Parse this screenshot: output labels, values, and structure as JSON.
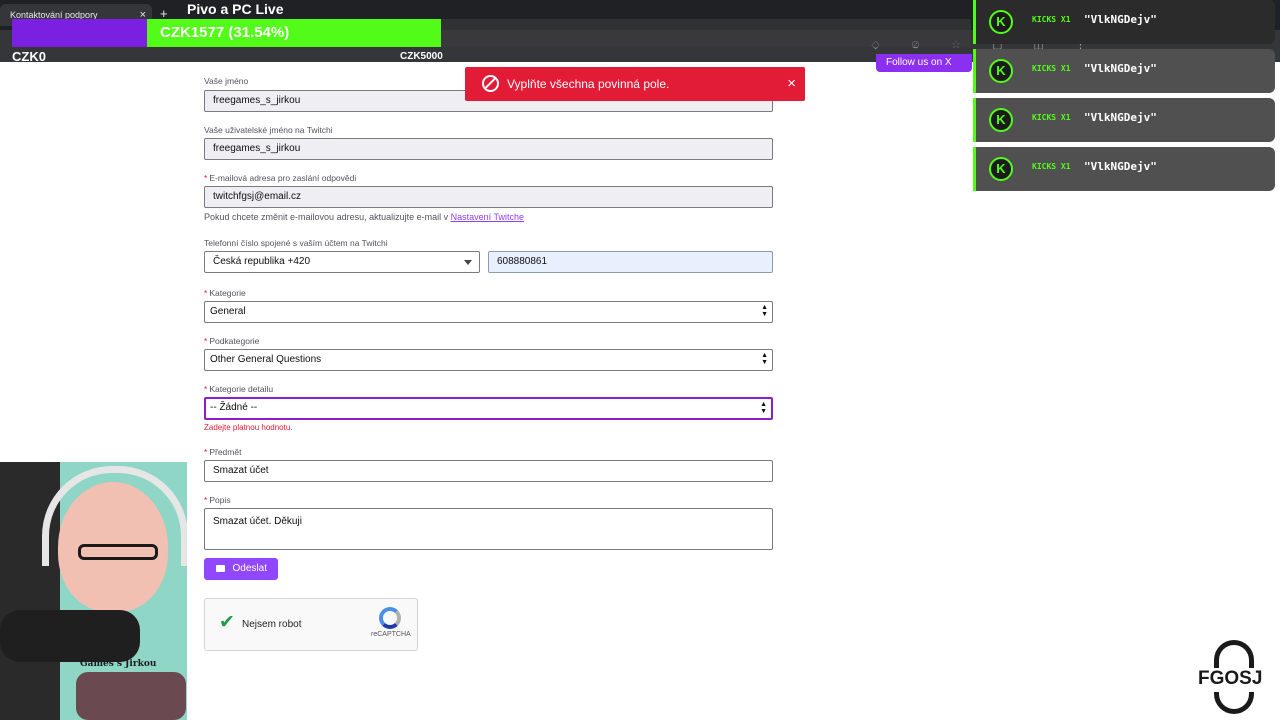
{
  "browser": {
    "tab_title": "Kontaktování podpory",
    "tab_close": "×",
    "new_tab": "+"
  },
  "stream": {
    "title": "Pivo a PC Live",
    "goal_current": "CZK1577 (31.54%)",
    "goal_progress_percent": 31.54,
    "goal_min": "CZK0",
    "goal_max": "CZK5000",
    "follow_label": "Follow us on X",
    "accent_color": "#53fc18",
    "brand_color": "#9147ff"
  },
  "kick_alerts": [
    {
      "tag": "KICKS X1",
      "name": "\"VlkNGDejv\""
    },
    {
      "tag": "KICKS X1",
      "name": "\"VlkNGDejv\""
    },
    {
      "tag": "KICKS X1",
      "name": "\"VlkNGDejv\""
    },
    {
      "tag": "KICKS X1",
      "name": "\"VlkNGDejv\""
    }
  ],
  "toast": {
    "message": "Vyplňte všechna povinná pole.",
    "close": "×",
    "color": "#e21b36"
  },
  "form": {
    "name_label": "Vaše jméno",
    "name_value": "freegames_s_jirkou",
    "username_label": "Vaše uživatelské jméno na Twitchi",
    "username_value": "freegames_s_jirkou",
    "email_label": "E-mailová adresa pro zaslání odpovědi",
    "email_value": "twitchfgsj@email.cz",
    "email_helper": "Pokud chcete změnit e-mailovou adresu, aktualizujte e-mail v",
    "email_helper_link": "Nastavení Twitche",
    "phone_label": "Telefonní číslo spojené s vaším účtem na Twitchi",
    "phone_country": "Česká republika +420",
    "phone_value": "608880861",
    "category_label": "Kategorie",
    "category_value": "General",
    "subcategory_label": "Podkategorie",
    "subcategory_value": "Other General Questions",
    "detail_label": "Kategorie detailu",
    "detail_value": "-- Žádné --",
    "detail_error": "Zadejte platnou hodnotu.",
    "subject_label": "Předmět",
    "subject_value": "Smazat účet",
    "description_label": "Popis",
    "description_value": "Smazat účet. Děkuji",
    "required_mark": "*",
    "submit_label": "Odeslat"
  },
  "captcha": {
    "label": "Nejsem robot",
    "brand": "reCAPTCHA",
    "checked": true
  },
  "webcam": {
    "shirt_text": "Games s Jirkou"
  },
  "logo": {
    "text": "FGOSJ"
  }
}
